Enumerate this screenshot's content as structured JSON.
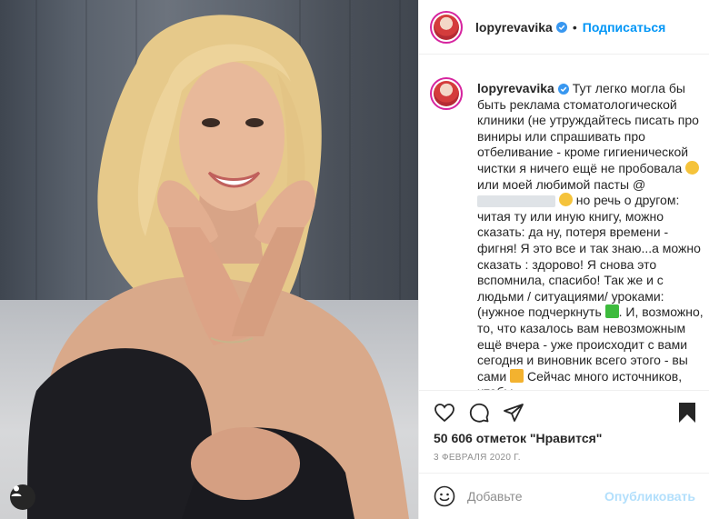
{
  "post": {
    "username": "lopyrevavika",
    "follow_label": "Подписаться",
    "separator": "•",
    "caption_parts": {
      "part1": "Тут легко могла бы быть реклама стоматологической клиники (не утруждайтесь писать про виниры или спрашивать про отбеливание - кроме гигиенической чистки я ничего ещё не пробовала ",
      "part2": " или моей любимой пасты @",
      "part3": " но речь о другом: читая ту или иную книгу, можно сказать: да ну, потеря времени - фигня! Я это все и так знаю...а можно сказать : здорово! Я снова это вспомнила, спасибо! Так же и с людьми / ситуациями/ уроками: (нужное подчеркнуть ",
      "part4": ". И, возможно, то, что казалось вам невозможным ещё вчера - уже происходит с вами сегодня и виновник всего этого - вы сами ",
      "part5": " Сейчас много источников, чтобы"
    },
    "likes": "50 606 отметок \"Нравится\"",
    "date": "3 ФЕВРАЛЯ 2020 Г.",
    "comment_placeholder": "Добавьте",
    "post_button": "Опубликовать"
  },
  "colors": {
    "follow": "#0095f6",
    "verified": "#3897f0",
    "post_disabled": "#b2dffc"
  },
  "icons": [
    "heart-icon",
    "comment-icon",
    "share-icon",
    "bookmark-icon",
    "emoji-icon",
    "user-tag-icon",
    "verified-icon"
  ]
}
